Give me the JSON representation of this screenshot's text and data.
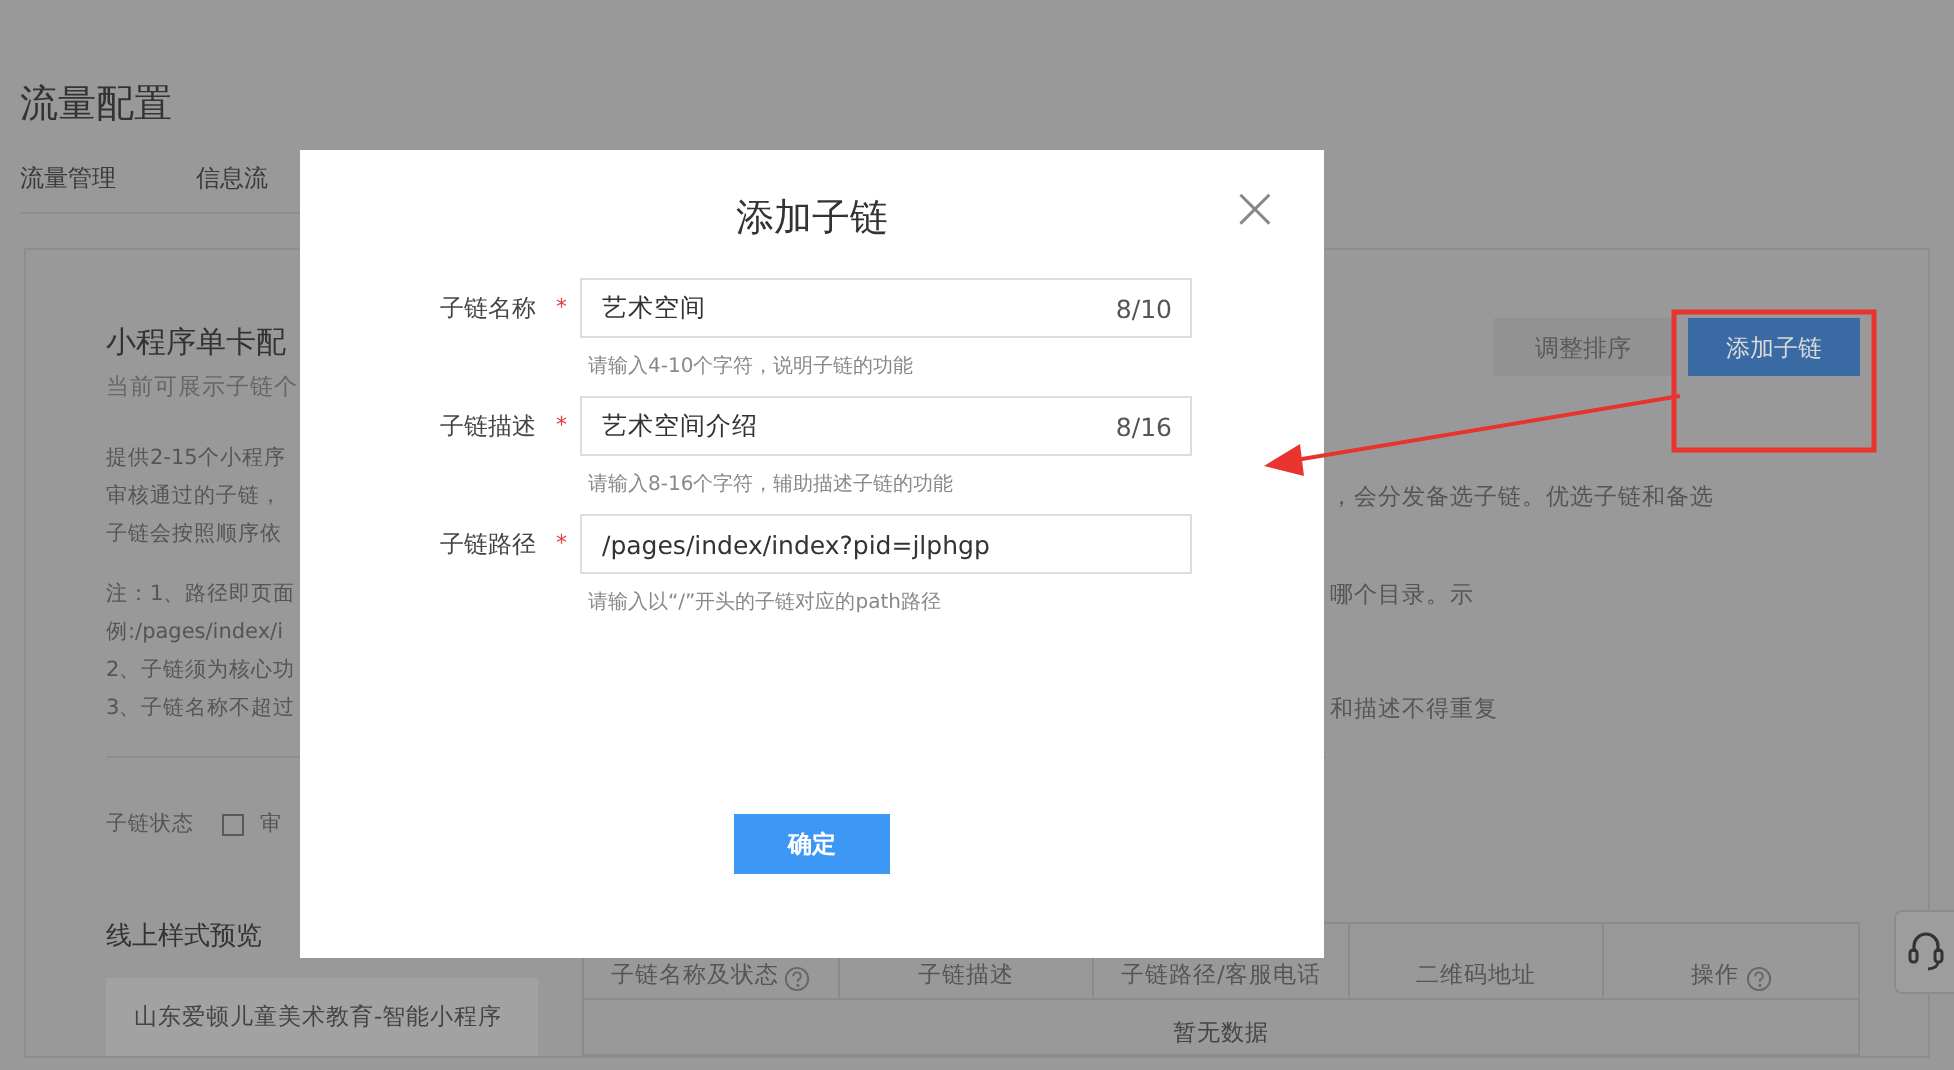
{
  "page": {
    "title": "流量配置",
    "tabs": [
      {
        "label": "流量管理"
      },
      {
        "label": "信息流"
      }
    ]
  },
  "card": {
    "title": "小程序单卡配",
    "subtitle": "当前可展示子链个",
    "buttons": [
      {
        "label": "调整排序",
        "disabled": true
      },
      {
        "label": "添加子链",
        "disabled": false
      }
    ],
    "description": [
      {
        "left": "提供2-15个小程序"
      },
      {
        "left": "审核通过的子链，",
        "right": "，会分发备选子链。优选子链和备选"
      },
      {
        "left": "子链会按照顺序依"
      }
    ],
    "notes": [
      {
        "left": "注：1、路径即页面",
        "right": "哪个目录。示"
      },
      {
        "left": "例:/pages/index/i"
      },
      {
        "left": "2、子链须为核心功"
      },
      {
        "left": "3、子链名称不超过",
        "right": "和描述不得重复"
      }
    ],
    "status": {
      "label": "子链状态",
      "checked": false,
      "option": "审"
    },
    "preview": {
      "title": "线上样式预览",
      "item": "山东爱顿儿童美术教育-智能小程序"
    },
    "table": {
      "columns": [
        {
          "label": "子链名称及状态",
          "help": true
        },
        {
          "label": "子链描述",
          "help": false
        },
        {
          "label": "子链路径/客服电话",
          "help": false
        },
        {
          "label": "二维码地址",
          "help": false
        },
        {
          "label": "操作",
          "help": true
        }
      ],
      "empty_text": "暂无数据"
    }
  },
  "modal": {
    "title": "添加子链",
    "close": "×",
    "fields": [
      {
        "label": "子链名称",
        "required_mark": "*",
        "value": "艺术空间",
        "counter": "8/10",
        "hint": "请输入4-10个字符，说明子链的功能"
      },
      {
        "label": "子链描述",
        "required_mark": "*",
        "value": "艺术空间介绍",
        "counter": "8/16",
        "hint": "请输入8-16个字符，辅助描述子链的功能"
      },
      {
        "label": "子链路径",
        "required_mark": "*",
        "value": "/pages/index/index?pid=jlphgp",
        "hint": "请输入以“/”开头的子链对应的path路径"
      }
    ],
    "confirm": "确定"
  }
}
